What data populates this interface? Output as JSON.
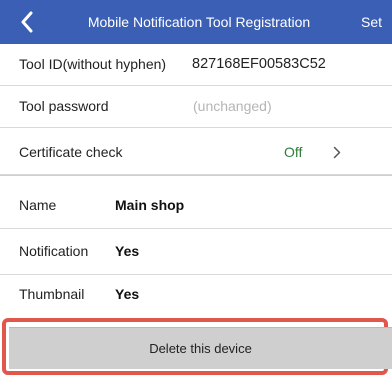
{
  "header": {
    "title": "Mobile Notification Tool Registration",
    "set_label": "Set",
    "back_icon": "chevron-left-icon"
  },
  "tool_id": {
    "label": "Tool ID(without hyphen)",
    "value": "827168EF00583C52"
  },
  "tool_password": {
    "label": "Tool password",
    "placeholder": "(unchanged)"
  },
  "certificate_check": {
    "label": "Certificate check",
    "value": "Off",
    "chevron_icon": "chevron-right-icon"
  },
  "name": {
    "label": "Name",
    "value": "Main shop"
  },
  "notification": {
    "label": "Notification",
    "value": "Yes"
  },
  "thumbnail": {
    "label": "Thumbnail",
    "value": "Yes"
  },
  "delete_button": {
    "label": "Delete this device"
  },
  "colors": {
    "header_bg": "#3b5fb5",
    "highlight": "#e2574c",
    "cert_value": "#2e7d3a",
    "delete_bg": "#cfcfcf"
  }
}
